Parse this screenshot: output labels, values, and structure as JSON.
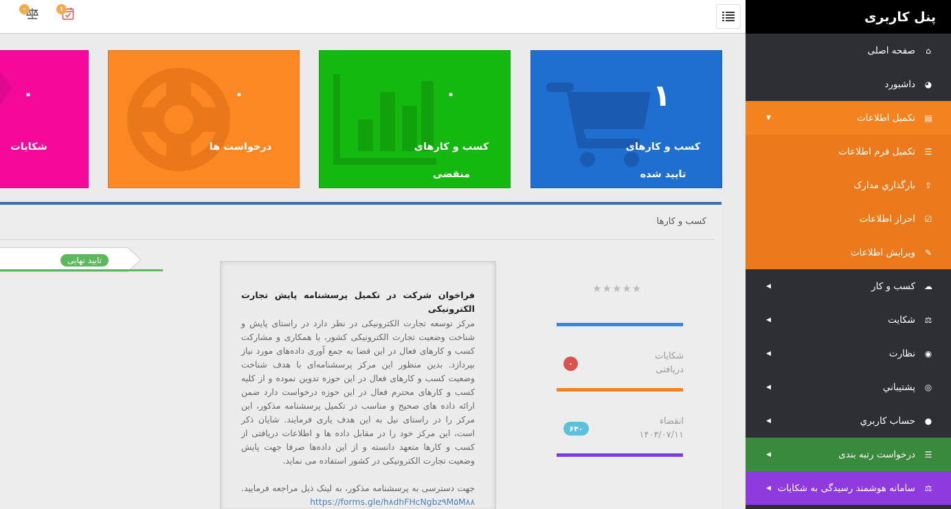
{
  "sidebar": {
    "brand": "پنل کاربری",
    "items": [
      {
        "label": "صفحه اصلی",
        "icon": "home-icon"
      },
      {
        "label": "داشبورد",
        "icon": "dashboard-icon"
      },
      {
        "label": "تکمیل اطلاعات",
        "icon": "id-card-icon"
      },
      {
        "label": "تکمیل فرم اطلاعات",
        "icon": "list-icon"
      },
      {
        "label": "بارگذاري مدارک",
        "icon": "upload-icon"
      },
      {
        "label": "احراز اطلاعات",
        "icon": "checkbox-icon"
      },
      {
        "label": "ویرایش اطلاعات",
        "icon": "edit-icon"
      },
      {
        "label": "کسب و کار",
        "icon": "cloud-icon"
      },
      {
        "label": "شکایت",
        "icon": "scale-icon"
      },
      {
        "label": "نظارت",
        "icon": "eye-icon"
      },
      {
        "label": "پشتيباني",
        "icon": "lifebuoy-icon"
      },
      {
        "label": "حساب کاربري",
        "icon": "user-icon"
      },
      {
        "label": "درخواست رتبه بندی",
        "icon": "list-icon"
      },
      {
        "label": "سامانه هوشمند رسیدگی به شکایات",
        "icon": "scale-icon"
      }
    ]
  },
  "topbar": {
    "menu_icon": "hamburger-icon",
    "calendar_badge": "۱",
    "scale_badge": "۰"
  },
  "cards": [
    {
      "value": "۱",
      "label_line1": "کسب و کارهای",
      "label_line2": "تایید شده",
      "color": "#1f6fd1",
      "icon": "cart-icon"
    },
    {
      "value": "۰",
      "label_line1": "کسب و کارهای",
      "label_line2": "منقضی",
      "color": "#13b90f",
      "icon": "bar-chart-icon"
    },
    {
      "value": "۰",
      "label_line1": "درخواست ها",
      "label_line2": "",
      "color": "#fb8822",
      "icon": "lifebuoy-icon"
    },
    {
      "value": "۰",
      "label_line1": "شکایات",
      "label_line2": "",
      "color": "#f4099b",
      "icon": "tag-icon"
    }
  ],
  "panel": {
    "title": "کسب و کارها",
    "status_badge": "تایید نهایی",
    "stars": "★★★★★",
    "complaints_label_line1": "شکایات",
    "complaints_label_line2": "دریافتی",
    "complaints_value": "۰",
    "expiry_label": "انقضاء",
    "expiry_date": "۱۴۰۳/۰۷/۱۱",
    "expiry_days": "۶۴۰",
    "colors": {
      "blue": "#2e88f0",
      "orange": "#f4821f",
      "purple": "#7a3de8",
      "red": "#d9534f",
      "cyan": "#5bc0de"
    }
  },
  "document": {
    "title": "فراخوان شرکت در تکمیل پرسشنامه پایش تجارت الکترونیکی",
    "body": "مرکز توسعه تجارت الکترونیکی در نظر دارد در راستای پایش و شناخت وضعیت تجارت الکترونیکی کشور، با همکاری و مشارکت کسب و کارهای فعال در این فضا به جمع آوری داده‌های مورد نیاز بپردازد. بدین منظور این مرکز پرسشنامه‌ای با هدف شناخت وضعیت کسب و کارهای فعال در این حوزه تدوین نموده و از کلیه کسب و کارهای محترم فعال در این حوزه درخواست دارد ضمن ارائه داده های صحیح و مناسب در تکمیل پرسشنامه مذکور، این مرکز را در راستای نیل به این هدف یاری فرمایند. شایان ذکر است، این مرکز خود را در مقابل داده ها و اطلاعات دریافتی از کسب و کارها متعهد دانسته و از این داده‌ها صرفا جهت پایش وضعیت تجارت الکترونیکی در کشور استفاده می نماید.",
    "footer": "جهت دسترسی به پرسشنامه مذکور، به لینک ذیل مراجعه فرمایید.",
    "link": "https://forms.gle/h۸dhFHcNgbz۹M۵M۸۸"
  }
}
